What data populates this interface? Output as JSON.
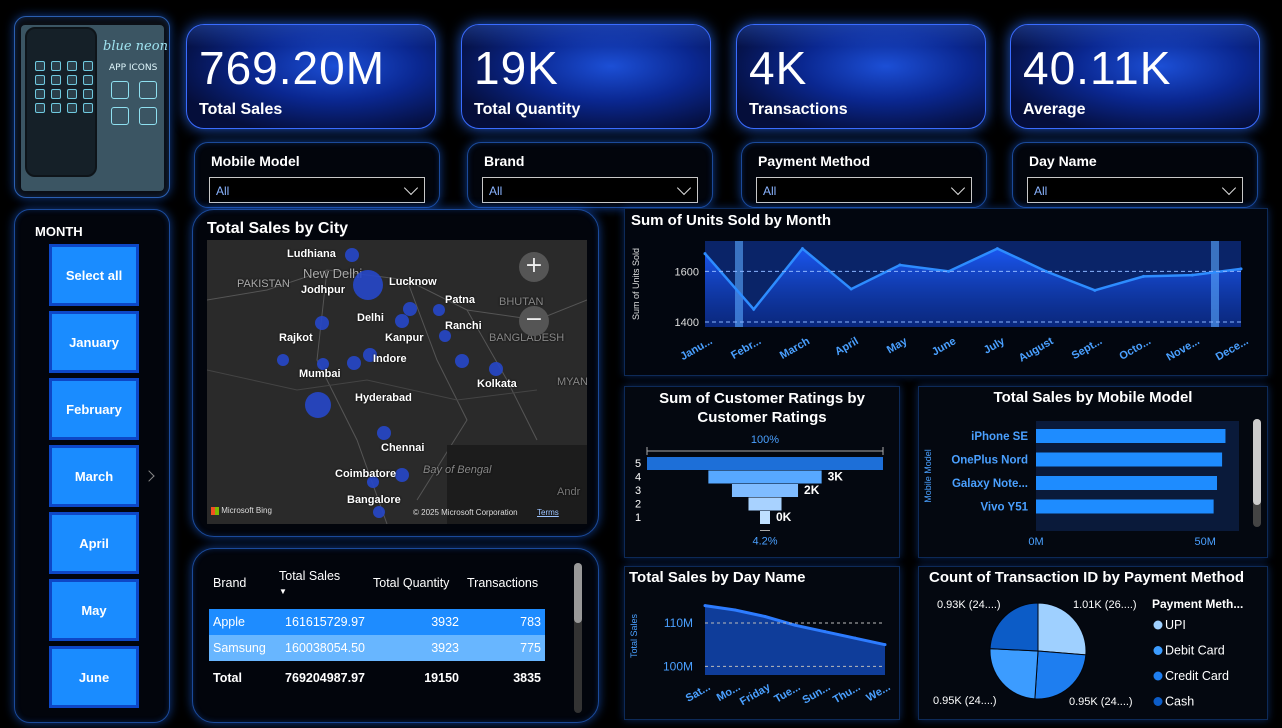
{
  "thumbnail": {
    "title": "blue neon",
    "subtitle": "APP ICONS"
  },
  "kpis": [
    {
      "value": "769.20M",
      "label": "Total Sales"
    },
    {
      "value": "19K",
      "label": "Total Quantity"
    },
    {
      "value": "4K",
      "label": "Transactions"
    },
    {
      "value": "40.11K",
      "label": "Average"
    }
  ],
  "slicers": [
    {
      "label": "Mobile Model",
      "value": "All"
    },
    {
      "label": "Brand",
      "value": "All"
    },
    {
      "label": "Payment Method",
      "value": "All"
    },
    {
      "label": "Day Name",
      "value": "All"
    }
  ],
  "month_slicer": {
    "header": "MONTH",
    "items": [
      "Select all",
      "January",
      "February",
      "March",
      "April",
      "May",
      "June"
    ]
  },
  "map": {
    "title": "Total Sales by City",
    "region_labels": [
      "PAKISTAN",
      "New Delhi",
      "BHUTAN",
      "BANGLADESH",
      "MYAN",
      "Bay of Bengal",
      "Andr"
    ],
    "cities": [
      "Ludhiana",
      "Lucknow",
      "Jodhpur",
      "Patna",
      "Delhi",
      "Ranchi",
      "Kanpur",
      "Rajkot",
      "Indore",
      "Mumbai",
      "Kolkata",
      "Hyderabad",
      "Chennai",
      "Coimbatore",
      "Bangalore"
    ],
    "provider": "Microsoft Bing",
    "copyright": "© 2025 Microsoft Corporation",
    "terms": "Terms",
    "zoom_in": "+",
    "zoom_out": "−"
  },
  "table": {
    "headers": [
      "Brand",
      "Total Sales",
      "Total Quantity",
      "Transactions"
    ],
    "rows": [
      [
        "Apple",
        "161615729.97",
        "3932",
        "783"
      ],
      [
        "Samsung",
        "160038054.50",
        "3923",
        "775"
      ]
    ],
    "total": [
      "Total",
      "769204987.97",
      "19150",
      "3835"
    ]
  },
  "chart_data": [
    {
      "type": "area",
      "title": "Sum of Units Sold by Month",
      "ylabel": "Sum of Units Sold",
      "categories": [
        "Janu...",
        "Febr...",
        "March",
        "April",
        "May",
        "June",
        "July",
        "August",
        "Sept...",
        "Octo...",
        "Nove...",
        "Dece..."
      ],
      "values": [
        1670,
        1450,
        1690,
        1530,
        1625,
        1600,
        1690,
        1600,
        1525,
        1580,
        1585,
        1610
      ],
      "ylim": [
        1380,
        1720
      ],
      "yticks": [
        "1600",
        "1400"
      ]
    },
    {
      "type": "bar",
      "title": "Sum of Customer Ratings by Customer Ratings",
      "categories": [
        "5",
        "4",
        "3",
        "2",
        "1"
      ],
      "values": [
        100,
        48,
        28,
        14,
        4.2
      ],
      "data_labels": [
        "",
        "3K",
        "2K",
        "",
        "0K"
      ],
      "top_label": "100%",
      "bottom_label": "4.2%"
    },
    {
      "type": "bar",
      "title": "Total Sales by Mobile Model",
      "ylabel": "Mobile Model",
      "categories": [
        "iPhone SE",
        "OnePlus Nord",
        "Galaxy Note...",
        "Vivo Y51"
      ],
      "values": [
        56,
        55,
        53.5,
        52.5
      ],
      "xticks": [
        "0M",
        "50M"
      ],
      "xlim": [
        0,
        60
      ]
    },
    {
      "type": "area",
      "title": "Total Sales by Day Name",
      "ylabel": "Total Sales",
      "categories": [
        "Sat...",
        "Mo...",
        "Friday",
        "Tue...",
        "Sun...",
        "Thu...",
        "We..."
      ],
      "values": [
        114,
        113,
        111.5,
        109.5,
        108,
        106.5,
        105
      ],
      "yticks": [
        "110M",
        "100M"
      ],
      "ylim": [
        98,
        116
      ]
    },
    {
      "type": "pie",
      "title": "Count of Transaction ID by Payment Method",
      "legend_title": "Payment Meth...",
      "series": [
        {
          "name": "UPI",
          "value": 1010,
          "label": "1.01K (26....)",
          "color": "#9fd0ff"
        },
        {
          "name": "Debit Card",
          "value": 950,
          "label": "0.95K (24....)",
          "color": "#3c9cff"
        },
        {
          "name": "Credit Card",
          "value": 950,
          "label": "0.95K (24....)",
          "color": "#1e7ef0"
        },
        {
          "name": "Cash",
          "value": 930,
          "label": "0.93K (24....)",
          "color": "#0c5cc7"
        }
      ]
    }
  ]
}
